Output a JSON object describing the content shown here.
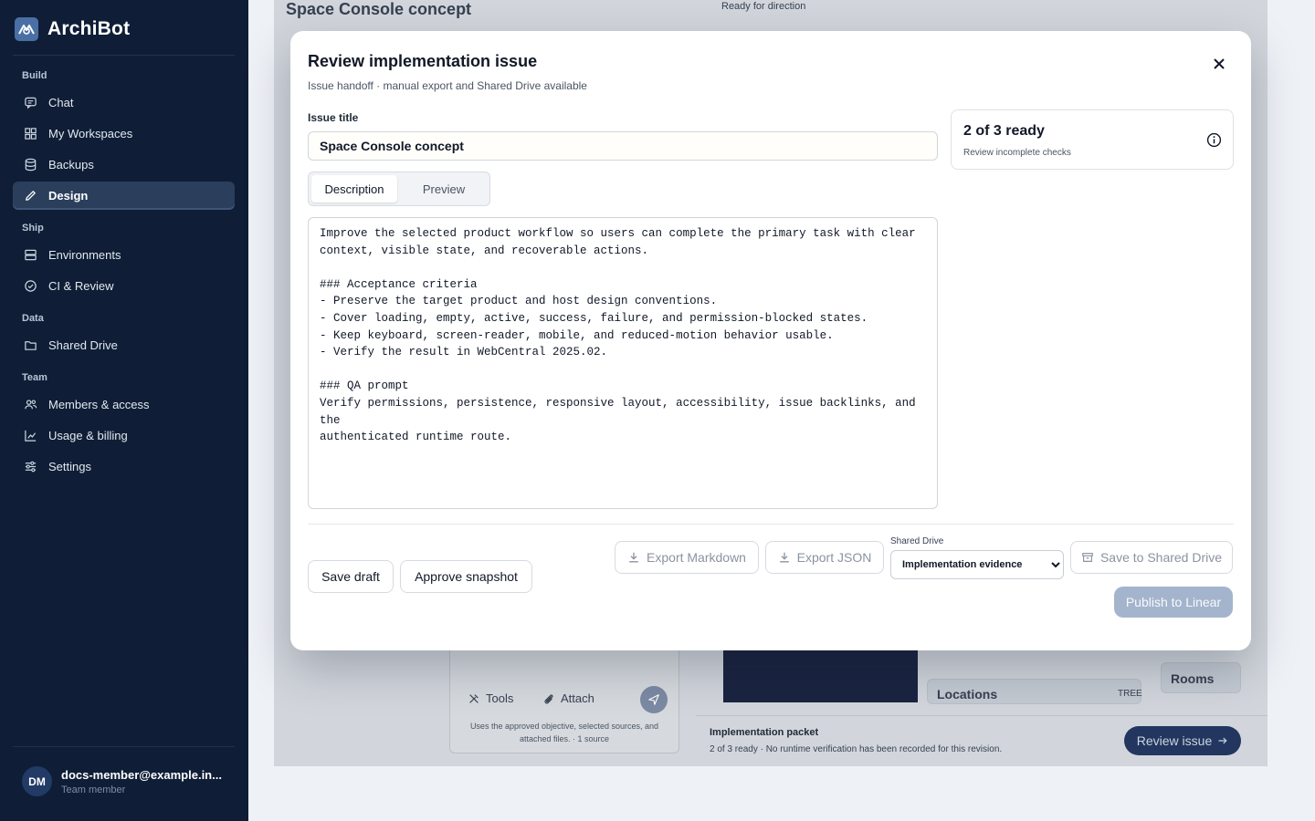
{
  "app": {
    "name": "ArchiBot"
  },
  "sidebar": {
    "groups": [
      {
        "label": "Build",
        "items": [
          {
            "label": "Chat",
            "icon": "chat-icon"
          },
          {
            "label": "My Workspaces",
            "icon": "grid-icon"
          },
          {
            "label": "Backups",
            "icon": "database-icon"
          },
          {
            "label": "Design",
            "icon": "pencil-icon",
            "active": true
          }
        ]
      },
      {
        "label": "Ship",
        "items": [
          {
            "label": "Environments",
            "icon": "server-icon"
          },
          {
            "label": "CI & Review",
            "icon": "check-circle-icon"
          }
        ]
      },
      {
        "label": "Data",
        "items": [
          {
            "label": "Shared Drive",
            "icon": "folder-icon"
          }
        ]
      },
      {
        "label": "Team",
        "items": [
          {
            "label": "Members & access",
            "icon": "users-icon"
          },
          {
            "label": "Usage & billing",
            "icon": "bar-chart-icon"
          },
          {
            "label": "Settings",
            "icon": "sliders-icon"
          }
        ]
      }
    ],
    "user": {
      "initials": "DM",
      "email": "docs-member@example.in...",
      "role": "Team member"
    }
  },
  "background": {
    "page_title": "Space Console concept",
    "status_text": "Ready for direction",
    "tools_label": "Tools",
    "attach_label": "Attach",
    "composer_hint": "Uses the approved objective, selected sources, and attached files. · 1 source",
    "locations_label": "Locations",
    "tree_label": "TREE",
    "rooms_label": "Rooms",
    "packet_title": "Implementation packet",
    "packet_sub": "2 of 3 ready · No runtime verification has been recorded for this revision.",
    "review_button": "Review issue"
  },
  "modal": {
    "title": "Review implementation issue",
    "subtitle": "Issue handoff · manual export and Shared Drive available",
    "issue_title_label": "Issue title",
    "issue_title_value": "Space Console concept",
    "tabs": {
      "description": "Description",
      "preview": "Preview"
    },
    "description": "Improve the selected product workflow so users can complete the primary task with clear\ncontext, visible state, and recoverable actions.\n\n### Acceptance criteria\n- Preserve the target product and host design conventions.\n- Cover loading, empty, active, success, failure, and permission-blocked states.\n- Keep keyboard, screen-reader, mobile, and reduced-motion behavior usable.\n- Verify the result in WebCentral 2025.02.\n\n### QA prompt\nVerify permissions, persistence, responsive layout, accessibility, issue backlinks, and the\nauthenticated runtime route.",
    "ready": {
      "title": "2 of 3 ready",
      "subtitle": "Review incomplete checks"
    },
    "actions": {
      "save_draft": "Save draft",
      "approve_snapshot": "Approve snapshot",
      "export_markdown": "Export Markdown",
      "export_json": "Export JSON",
      "shared_drive_label": "Shared Drive",
      "shared_drive_selected": "Implementation evidence",
      "save_to_shared_drive": "Save to Shared Drive",
      "publish": "Publish to Linear"
    }
  }
}
